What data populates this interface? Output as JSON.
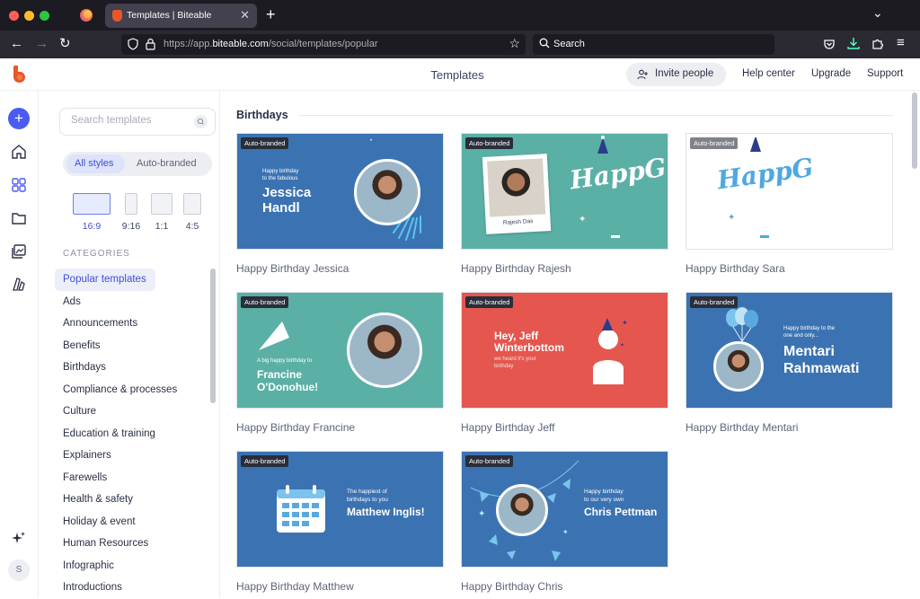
{
  "browser": {
    "tab_title": "Templates | Biteable",
    "url_prefix": "https://app.",
    "url_domain": "biteable.com",
    "url_path": "/social/templates/popular",
    "search_placeholder": "Search"
  },
  "header": {
    "title": "Templates",
    "invite_label": "Invite people",
    "links": [
      "Help center",
      "Upgrade",
      "Support"
    ]
  },
  "rail": {
    "avatar_initial": "S"
  },
  "sidebar": {
    "search_placeholder": "Search templates",
    "styles": [
      "All styles",
      "Auto-branded"
    ],
    "ratios": [
      "16:9",
      "9:16",
      "1:1",
      "4:5"
    ],
    "categories_heading": "CATEGORIES",
    "categories": [
      "Popular templates",
      "Ads",
      "Announcements",
      "Benefits",
      "Birthdays",
      "Compliance & processes",
      "Culture",
      "Education & training",
      "Explainers",
      "Farewells",
      "Health & safety",
      "Holiday & event",
      "Human Resources",
      "Infographic",
      "Introductions"
    ]
  },
  "main": {
    "section_title": "Birthdays",
    "badge": "Auto-branded",
    "cards": [
      {
        "name": "Happy Birthday Jessica",
        "line1": "Happy birthday",
        "line2": "to the fabulous",
        "headline": "Jessica Handl"
      },
      {
        "name": "Happy Birthday Rajesh",
        "script": "HappG",
        "caption": "Rajesh Das"
      },
      {
        "name": "Happy Birthday Sara",
        "script": "HappG"
      },
      {
        "name": "Happy Birthday Francine",
        "line1": "A big happy birthday to",
        "headline": "Francine O'Donohue!"
      },
      {
        "name": "Happy Birthday Jeff",
        "headline": "Hey, Jeff Winterbottom",
        "line1": "we heard it's your",
        "line2": "birthday"
      },
      {
        "name": "Happy Birthday Mentari",
        "line1": "Happy birthday to the",
        "line2": "one and only...",
        "headline": "Mentari Rahmawati"
      },
      {
        "name": "Happy Birthday Matthew",
        "line1": "The happiest of",
        "line2": "birthdays to you",
        "headline": "Matthew Inglis!"
      },
      {
        "name": "Happy Birthday Chris",
        "line1": "Happy birthday",
        "line2": "to our very own",
        "headline": "Chris Pettman"
      }
    ]
  },
  "colors": {
    "accent": "#4a5cf0",
    "brand": "#e8572a",
    "card_blue": "#3b73b2",
    "card_teal": "#5bb0a6",
    "card_coral": "#e5564f"
  }
}
